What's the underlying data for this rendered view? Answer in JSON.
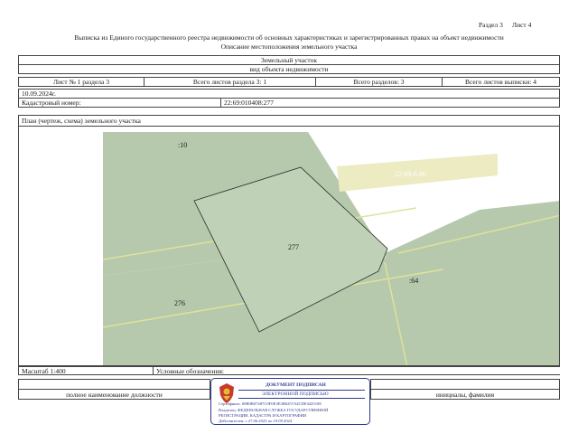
{
  "header": {
    "section": "Раздел 3",
    "sheet": "Лист 4",
    "title": "Выписка из Единого государственного реестра недвижимости об основных характеристиках и зарегистрированных правах на объект недвижимости",
    "subtitle": "Описание местоположения земельного участка"
  },
  "object": {
    "type": "Земельный участок",
    "type_caption": "вид объекта недвижимости"
  },
  "sheets_row": {
    "sheet_no": "Лист № 1 раздела 3",
    "total_section_sheets": "Всего листов раздела 3: 1",
    "total_sections": "Всего разделов: 3",
    "total_extract_sheets": "Всего листов выписки: 4"
  },
  "date": "10.09.2024г.",
  "cadastral": {
    "label": "Кадастровый номер:",
    "value": "22:69:010408:277"
  },
  "plan": {
    "label": "План (чертеж, схема) земельного участка",
    "labels": {
      "p10": ":10",
      "p277": "277",
      "p276": "276",
      "p64": ":64",
      "road": "22:69-6.80"
    },
    "colors": {
      "parcel": "#b6c9ad",
      "road": "#ecebc1",
      "boundary": "#dfe29a"
    }
  },
  "footer": {
    "scale": "Масштаб 1:400",
    "legend": "Условные обозначения:",
    "position_caption": "полное наименование должности",
    "name_caption": "инициалы, фамилия"
  },
  "stamp": {
    "title": "ДОКУМЕНТ ПОДПИСАН",
    "subtitle": "ЭЛЕКТРОННОЙ ПОДПИСЬЮ",
    "certificate": "Сертификат: 00B0B07487C0F0E3E3B0257A4CDF4425108",
    "owner1": "Владелец: ФЕДЕРАЛЬНАЯ СЛУЖБА ГОСУДАРСТВЕННОЙ",
    "owner2": "РЕГИСТРАЦИИ, КАДАСТРА И КАРТОГРАФИИ",
    "validity": "Действителен: с 27.06.2023 по 19.09.2024"
  }
}
